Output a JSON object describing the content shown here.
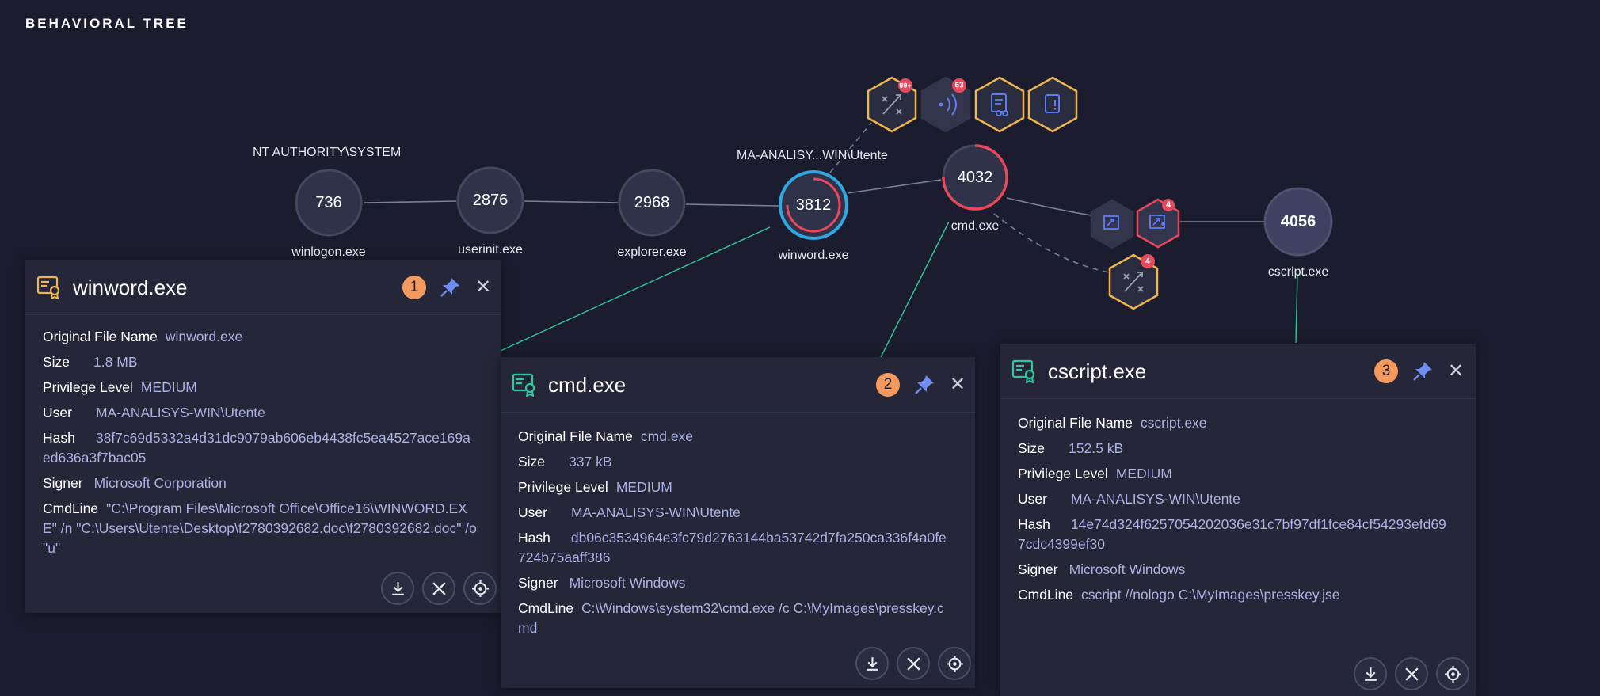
{
  "page": {
    "title": "BEHAVIORAL TREE"
  },
  "graph": {
    "user_labels": {
      "system": "NT AUTHORITY\\SYSTEM",
      "analyst": "MA-ANALISY...WIN\\Utente"
    },
    "nodes": [
      {
        "pid": "736",
        "name": "winlogon.exe"
      },
      {
        "pid": "2876",
        "name": "userinit.exe"
      },
      {
        "pid": "2968",
        "name": "explorer.exe"
      },
      {
        "pid": "3812",
        "name": "winword.exe"
      },
      {
        "pid": "4032",
        "name": "cmd.exe"
      },
      {
        "pid": "4056",
        "name": "cscript.exe"
      }
    ],
    "hex_badges": {
      "top_1": "99+",
      "top_2": "63",
      "mid_red": "4",
      "lower": "4"
    }
  },
  "panels": [
    {
      "title": "winword.exe",
      "number": "1",
      "fields": {
        "original_file_name_label": "Original File Name",
        "original_file_name": "winword.exe",
        "size_label": "Size",
        "size": "1.8 MB",
        "privilege_label": "Privilege Level",
        "privilege": "MEDIUM",
        "user_label": "User",
        "user": "MA-ANALISYS-WIN\\Utente",
        "hash_label": "Hash",
        "hash": "38f7c69d5332a4d31dc9079ab606eb4438fc5ea4527ace169aed636a3f7bac05",
        "signer_label": "Signer",
        "signer": "Microsoft Corporation",
        "cmdline_label": "CmdLine",
        "cmdline": "\"C:\\Program Files\\Microsoft Office\\Office16\\WINWORD.EXE\" /n \"C:\\Users\\Utente\\Desktop\\f2780392682.doc\\f2780392682.doc\" /o \"u\""
      }
    },
    {
      "title": "cmd.exe",
      "number": "2",
      "fields": {
        "original_file_name_label": "Original File Name",
        "original_file_name": "cmd.exe",
        "size_label": "Size",
        "size": "337 kB",
        "privilege_label": "Privilege Level",
        "privilege": "MEDIUM",
        "user_label": "User",
        "user": "MA-ANALISYS-WIN\\Utente",
        "hash_label": "Hash",
        "hash": "db06c3534964e3fc79d2763144ba53742d7fa250ca336f4a0fe724b75aaff386",
        "signer_label": "Signer",
        "signer": "Microsoft Windows",
        "cmdline_label": "CmdLine",
        "cmdline": "C:\\Windows\\system32\\cmd.exe /c C:\\MyImages\\presskey.cmd"
      }
    },
    {
      "title": "cscript.exe",
      "number": "3",
      "fields": {
        "original_file_name_label": "Original File Name",
        "original_file_name": "cscript.exe",
        "size_label": "Size",
        "size": "152.5 kB",
        "privilege_label": "Privilege Level",
        "privilege": "MEDIUM",
        "user_label": "User",
        "user": "MA-ANALISYS-WIN\\Utente",
        "hash_label": "Hash",
        "hash": "14e74d324f6257054202036e31c7bf97df1fce84cf54293efd697cdc4399ef30",
        "signer_label": "Signer",
        "signer": "Microsoft Windows",
        "cmdline_label": "CmdLine",
        "cmdline": "cscript //nologo C:\\MyImages\\presskey.jse"
      }
    }
  ],
  "colors": {
    "background": "#1b1d2e",
    "panel": "#252738",
    "accent_orange": "#f59a5e",
    "accent_green": "#2fc79d",
    "accent_red": "#e8485c",
    "accent_blue": "#2fa7e0",
    "hex_gold": "#f0b64c",
    "value_text": "#aab0e0"
  }
}
